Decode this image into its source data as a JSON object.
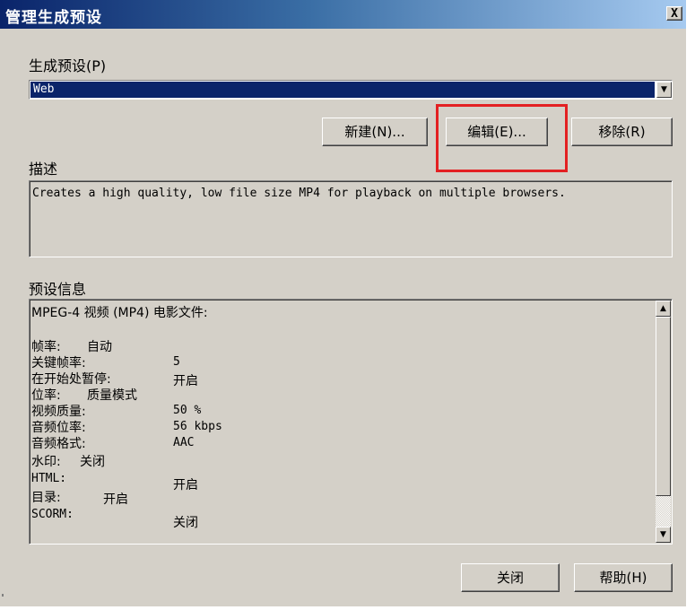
{
  "window": {
    "title": "管理生成预设",
    "close_label": "X"
  },
  "preset": {
    "label": "生成预设(P)",
    "selected": "Web"
  },
  "buttons": {
    "new": "新建(N)...",
    "edit": "编辑(E)...",
    "remove": "移除(R)",
    "close": "关闭",
    "help": "帮助(H)"
  },
  "description": {
    "label": "描述",
    "text": "Creates a high quality, low file size MP4 for playback on multiple browsers."
  },
  "info": {
    "label": "预设信息",
    "header": "MPEG-4 视频 (MP4) 电影文件:",
    "rows": [
      {
        "key": "帧率:",
        "value": "自动"
      },
      {
        "key": "关键帧率:",
        "value": "5"
      },
      {
        "key": "在开始处暂停:",
        "value": "开启"
      },
      {
        "key": "位率:",
        "value": "质量模式"
      },
      {
        "key": "视频质量:",
        "value": "50 %"
      },
      {
        "key": "音频位率:",
        "value": "56 kbps"
      },
      {
        "key": "音频格式:",
        "value": "AAC"
      },
      {
        "key": "水印:",
        "value": "关闭"
      },
      {
        "key": "HTML:",
        "value": "开启"
      },
      {
        "key": "目录:",
        "value": "开启"
      },
      {
        "key": "SCORM:",
        "value": "关闭"
      }
    ]
  },
  "icons": {
    "dropdown": "chevron-down-icon",
    "scroll_up": "scroll-up-arrow-icon",
    "scroll_down": "scroll-down-arrow-icon"
  }
}
